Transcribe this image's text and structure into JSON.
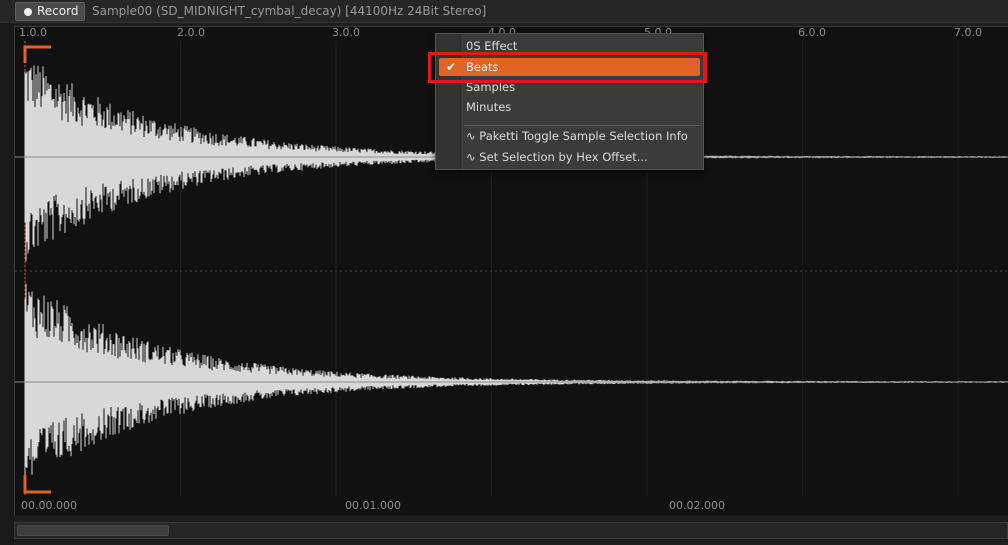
{
  "toolbar": {
    "record_label": "Record",
    "sample_title": "Sample00 (SD_MIDNIGHT_cymbal_decay) [44100Hz 24Bit Stereo]"
  },
  "ruler_top": {
    "labels": [
      "1.0.0",
      "2.0.0",
      "3.0.0",
      "4.0.0",
      "5.0.0",
      "6.0.0",
      "7.0.0"
    ]
  },
  "ruler_bottom": {
    "labels": [
      "00.00.000",
      "00.01.000",
      "00.02.000"
    ]
  },
  "context_menu": {
    "items": [
      {
        "label": "0S Effect",
        "checked": false
      },
      {
        "label": "Beats",
        "checked": true
      },
      {
        "label": "Samples",
        "checked": false
      },
      {
        "label": "Minutes",
        "checked": false
      },
      {
        "label": "∿ Paketti Toggle Sample Selection Info",
        "checked": false
      },
      {
        "label": "∿ Set Selection by Hex Offset...",
        "checked": false
      }
    ],
    "check_glyph": "✔"
  },
  "colors": {
    "accent": "#e06426",
    "highlight": "#e8131b",
    "waveform": "#d8d8d8",
    "background": "#111111"
  }
}
